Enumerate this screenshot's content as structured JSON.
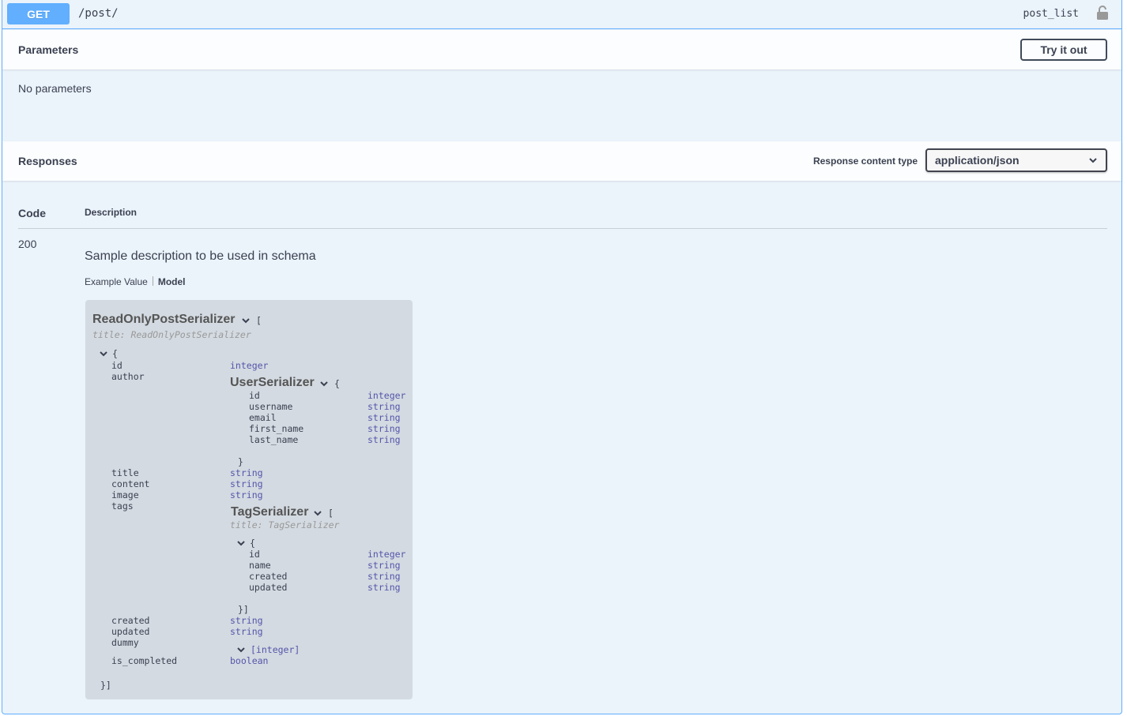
{
  "summary": {
    "method": "GET",
    "path": "/post/",
    "operation_id": "post_list"
  },
  "parameters": {
    "title": "Parameters",
    "try_button": "Try it out",
    "empty_text": "No parameters"
  },
  "responses": {
    "title": "Responses",
    "content_type_label": "Response content type",
    "content_type_value": "application/json",
    "col_code": "Code",
    "col_description": "Description",
    "code": "200",
    "description": "Sample description to be used in schema",
    "tab_example": "Example Value",
    "tab_model": "Model"
  },
  "model": {
    "name": "ReadOnlyPostSerializer",
    "title_line": "title: ReadOnlyPostSerializer",
    "open_bracket": "[",
    "open_brace": "{",
    "close": "}]",
    "props": {
      "id": "id",
      "id_type": "integer",
      "author": "author",
      "title": "title",
      "title_type": "string",
      "content": "content",
      "content_type": "string",
      "image": "image",
      "image_type": "string",
      "tags": "tags",
      "created": "created",
      "created_type": "string",
      "updated": "updated",
      "updated_type": "string",
      "dummy": "dummy",
      "dummy_type": "[integer]",
      "is_completed": "is_completed",
      "is_completed_type": "boolean"
    },
    "user": {
      "name": "UserSerializer",
      "open": "{",
      "close": "}",
      "fields": [
        {
          "name": "id",
          "type": "integer"
        },
        {
          "name": "username",
          "type": "string"
        },
        {
          "name": "email",
          "type": "string"
        },
        {
          "name": "first_name",
          "type": "string"
        },
        {
          "name": "last_name",
          "type": "string"
        }
      ]
    },
    "tag": {
      "name": "TagSerializer",
      "open_bracket": "[",
      "title_line": "title: TagSerializer",
      "open": "{",
      "close": "}]",
      "fields": [
        {
          "name": "id",
          "type": "integer"
        },
        {
          "name": "name",
          "type": "string"
        },
        {
          "name": "created",
          "type": "string"
        },
        {
          "name": "updated",
          "type": "string"
        }
      ]
    }
  },
  "colors": {
    "get_accent": "#61affe",
    "panel_bg": "#ebf3fb",
    "type_color": "#55a"
  }
}
